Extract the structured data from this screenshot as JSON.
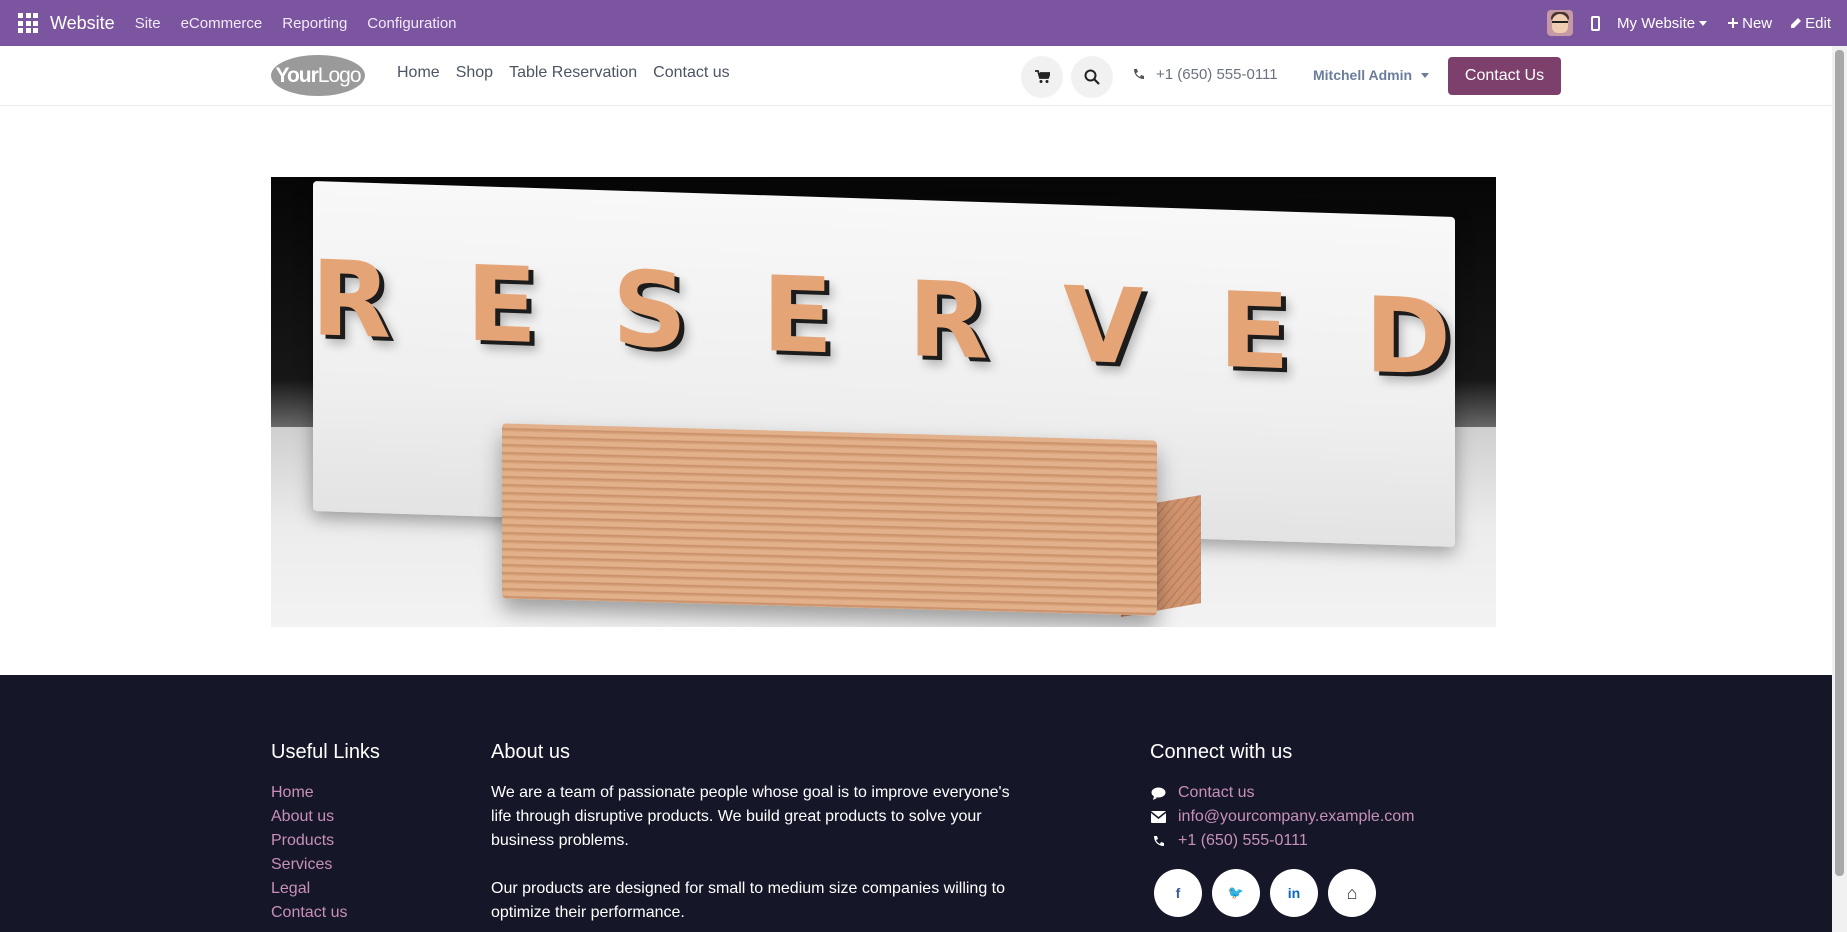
{
  "admin_bar": {
    "app_name": "Website",
    "menu": [
      "Site",
      "eCommerce",
      "Reporting",
      "Configuration"
    ],
    "website_switch": "My Website",
    "new_label": "New",
    "edit_label": "Edit"
  },
  "header": {
    "logo_text_bold": "Your",
    "logo_text": "Logo",
    "nav": [
      "Home",
      "Shop",
      "Table Reservation",
      "Contact us"
    ],
    "phone": "+1 (650) 555-0111",
    "user": "Mitchell Admin",
    "contact_button": "Contact Us"
  },
  "hero": {
    "letters": [
      "R",
      "E",
      "S",
      "E",
      "R",
      "V",
      "E",
      "D"
    ]
  },
  "footer": {
    "useful_links_title": "Useful Links",
    "useful_links": [
      "Home",
      "About us",
      "Products",
      "Services",
      "Legal",
      "Contact us"
    ],
    "about_title": "About us",
    "about_p1": "We are a team of passionate people whose goal is to improve everyone's life through disruptive products. We build great products to solve your business problems.",
    "about_p2": "Our products are designed for small to medium size companies willing to optimize their performance.",
    "connect_title": "Connect with us",
    "connect_contact": "Contact us",
    "connect_email": "info@yourcompany.example.com",
    "connect_phone": "+1 (650) 555-0111",
    "social": [
      {
        "icon": "facebook-icon",
        "glyph": "f"
      },
      {
        "icon": "twitter-icon",
        "glyph": "🐦"
      },
      {
        "icon": "linkedin-icon",
        "glyph": "in"
      },
      {
        "icon": "home-icon",
        "glyph": "⌂"
      }
    ]
  },
  "colors": {
    "admin_bar": "#7c55a0",
    "primary_button": "#7d3f6c",
    "footer_bg": "#151729",
    "footer_link": "#c78fb9"
  }
}
